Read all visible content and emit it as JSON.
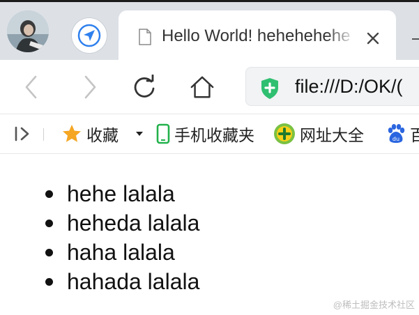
{
  "tab": {
    "title": "Hello World! hehehehehe"
  },
  "toolbar": {
    "back_icon": "back-arrow-icon",
    "forward_icon": "forward-arrow-icon",
    "reload_icon": "reload-icon",
    "home_icon": "home-icon",
    "url": "file:///D:/OK/("
  },
  "bookmarks": {
    "items": [
      {
        "label": "收藏",
        "icon": "star-icon"
      },
      {
        "label": "手机收藏夹",
        "icon": "phone-icon"
      },
      {
        "label": "网址大全",
        "icon": "plus-circle-icon"
      },
      {
        "label": "百",
        "icon": "baidu-paw-icon"
      }
    ]
  },
  "content": {
    "items": [
      "hehe lalala",
      "heheda lalala",
      "haha lalala",
      "hahada lalala"
    ]
  },
  "watermark": "@稀土掘金技术社区",
  "colors": {
    "tabstrip_bg": "#dde1e6",
    "nav_blue": "#2f80ed",
    "shield_green": "#2fbf71",
    "star_orange": "#f5a623",
    "phone_green": "#22b14c",
    "baidu_blue": "#2b66e0"
  }
}
